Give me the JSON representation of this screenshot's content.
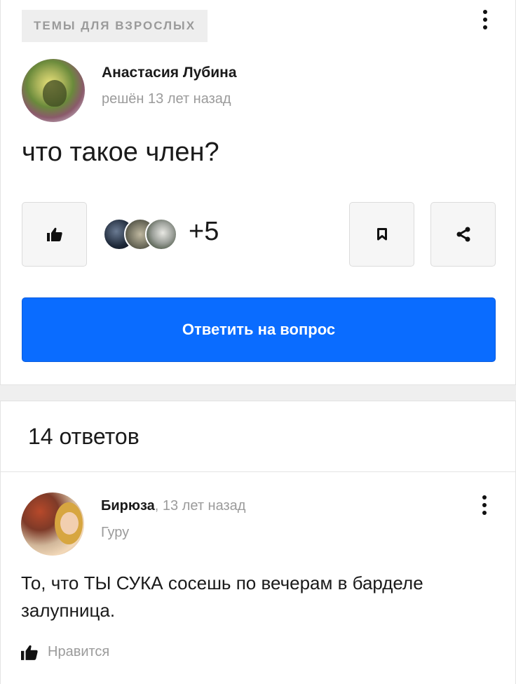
{
  "question": {
    "category": "ТЕМЫ ДЛЯ ВЗРОСЛЫХ",
    "author_name": "Анастасия Лубина",
    "author_meta": "решён 13 лет назад",
    "title": "что такое член?",
    "likers_count": "+5",
    "answer_button": "Ответить на вопрос"
  },
  "answers": {
    "count_label": "14 ответов",
    "items": [
      {
        "name": "Бирюза",
        "time": ", 13 лет назад",
        "rank": "Гуру",
        "text": "То, что ТЫ СУКА сосешь по вечерам в барделе залупница.",
        "like_label": "Нравится"
      }
    ]
  },
  "icons": {
    "like": "thumbs-up-icon",
    "bookmark": "bookmark-icon",
    "share": "share-icon",
    "more": "more-vertical-icon"
  },
  "colors": {
    "accent": "#0a6cff",
    "muted_text": "#9b9b9b",
    "chip_bg": "#eeeeee"
  }
}
